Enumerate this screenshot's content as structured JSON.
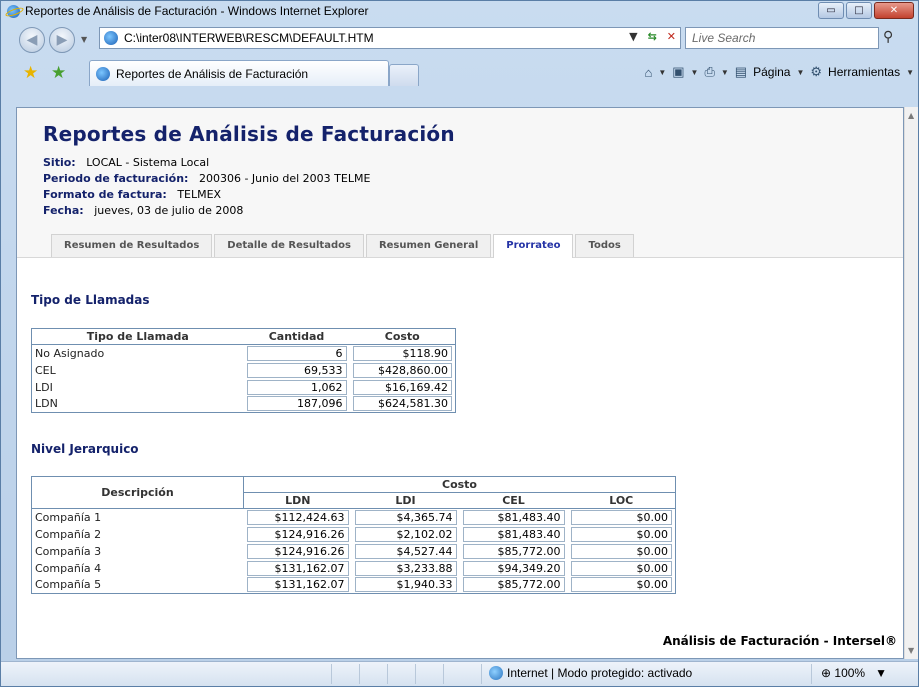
{
  "window": {
    "title": "Reportes de Análisis de Facturación - Windows Internet Explorer",
    "minimize": "▭",
    "maximize": "□",
    "close": "✕"
  },
  "browser": {
    "address": "C:\\inter08\\INTERWEB\\RESCM\\DEFAULT.HTM",
    "search_placeholder": "Live Search",
    "tab_title": "Reportes de Análisis de Facturación",
    "toolbar": {
      "page_label": "Página",
      "tools_label": "Herramientas"
    }
  },
  "report": {
    "title": "Reportes de Análisis de Facturación",
    "fields": [
      {
        "label": "Sitio:",
        "value": "LOCAL - Sistema Local"
      },
      {
        "label": "Periodo de facturación:",
        "value": "200306 - Junio del 2003 TELME"
      },
      {
        "label": "Formato de factura:",
        "value": "TELMEX"
      },
      {
        "label": "Fecha:",
        "value": "jueves, 03 de julio de 2008"
      }
    ],
    "tabs": [
      "Resumen de Resultados",
      "Detalle de Resultados",
      "Resumen General",
      "Prorrateo",
      "Todos"
    ],
    "active_tab": "Prorrateo"
  },
  "tipo_llamadas": {
    "title": "Tipo de Llamadas",
    "headers": [
      "Tipo de Llamada",
      "Cantidad",
      "Costo"
    ],
    "rows": [
      [
        "No Asignado",
        "6",
        "$118.90"
      ],
      [
        "CEL",
        "69,533",
        "$428,860.00"
      ],
      [
        "LDI",
        "1,062",
        "$16,169.42"
      ],
      [
        "LDN",
        "187,096",
        "$624,581.30"
      ]
    ]
  },
  "nivel_jerarquico": {
    "title": "Nivel Jerarquico",
    "group_header": "Costo",
    "desc_header": "Descripción",
    "headers": [
      "LDN",
      "LDI",
      "CEL",
      "LOC"
    ],
    "rows": [
      [
        "Compañía 1",
        "$112,424.63",
        "$4,365.74",
        "$81,483.40",
        "$0.00"
      ],
      [
        "Compañía 2",
        "$124,916.26",
        "$2,102.02",
        "$81,483.40",
        "$0.00"
      ],
      [
        "Compañía 3",
        "$124,916.26",
        "$4,527.44",
        "$85,772.00",
        "$0.00"
      ],
      [
        "Compañía 4",
        "$131,162.07",
        "$3,233.88",
        "$94,349.20",
        "$0.00"
      ],
      [
        "Compañía 5",
        "$131,162.07",
        "$1,940.33",
        "$85,772.00",
        "$0.00"
      ]
    ]
  },
  "footer": {
    "brand": "Análisis de Facturación - Intersel®"
  },
  "status": {
    "zone": "Internet | Modo protegido: activado",
    "zoom": "100%"
  }
}
